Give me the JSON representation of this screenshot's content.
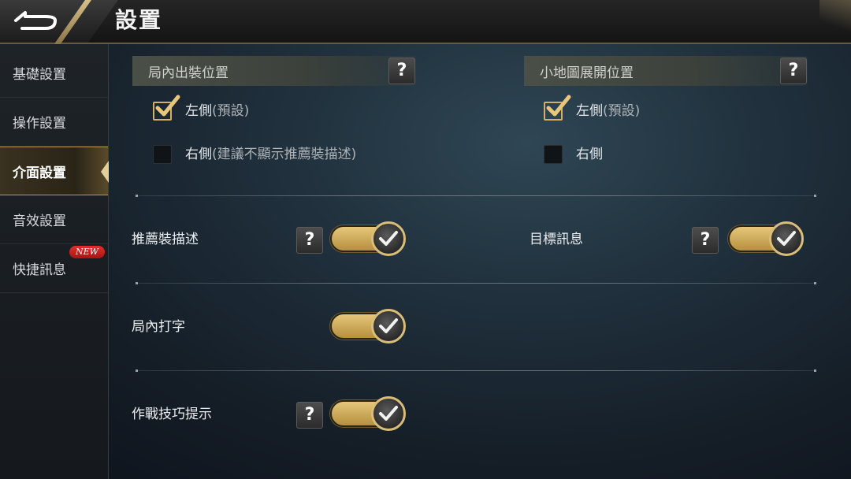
{
  "header": {
    "title": "設置"
  },
  "sidebar": {
    "items": [
      {
        "label": "基礎設置"
      },
      {
        "label": "操作設置"
      },
      {
        "label": "介面設置"
      },
      {
        "label": "音效設置"
      },
      {
        "label": "快捷訊息",
        "badge": "NEW"
      }
    ],
    "active_index": 2
  },
  "sections": {
    "equip_position": {
      "title": "局內出裝位置",
      "help": "?",
      "options": [
        {
          "label": "左側",
          "note": "(預設)",
          "checked": true
        },
        {
          "label": "右側",
          "note": "(建議不顯示推薦裝描述)",
          "checked": false
        }
      ]
    },
    "minimap_position": {
      "title": "小地圖展開位置",
      "help": "?",
      "options": [
        {
          "label": "左側",
          "note": "(預設)",
          "checked": true
        },
        {
          "label": "右側",
          "note": "",
          "checked": false
        }
      ]
    }
  },
  "toggles": {
    "recommended_equip_desc": {
      "label": "推薦裝描述",
      "help": "?",
      "on": true
    },
    "target_info": {
      "label": "目標訊息",
      "help": "?",
      "on": true
    },
    "in_game_typing": {
      "label": "局內打字",
      "on": true
    },
    "combat_tips": {
      "label": "作戰技巧提示",
      "help": "?",
      "on": true
    }
  },
  "colors": {
    "accent_gold": "#d3b06a",
    "new_badge": "#d62a28"
  },
  "icons": {
    "back": "back-arrow-icon",
    "check": "checkmark-icon",
    "help": "question-icon"
  }
}
